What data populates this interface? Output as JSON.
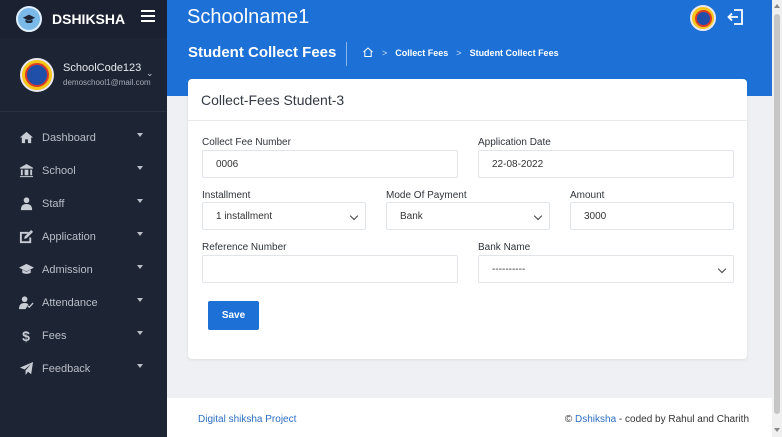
{
  "brand": {
    "name": "DSHIKSHA",
    "logo_icon": "graduation-cap-icon"
  },
  "profile": {
    "name": "SchoolCode123",
    "email": "demoschool1@mail.com"
  },
  "sidebar": {
    "items": [
      {
        "label": "Dashboard",
        "icon": "home-icon"
      },
      {
        "label": "School",
        "icon": "school-icon"
      },
      {
        "label": "Staff",
        "icon": "staff-icon"
      },
      {
        "label": "Application",
        "icon": "application-icon"
      },
      {
        "label": "Admission",
        "icon": "admission-icon"
      },
      {
        "label": "Attendance",
        "icon": "attendance-icon"
      },
      {
        "label": "Fees",
        "icon": "dollar-icon"
      },
      {
        "label": "Feedback",
        "icon": "paper-plane-icon"
      }
    ]
  },
  "header": {
    "school_name": "Schoolname1"
  },
  "subheader": {
    "page_title": "Student Collect Fees",
    "breadcrumb": [
      "Collect Fees",
      "Student Collect Fees"
    ]
  },
  "form": {
    "title": "Collect-Fees Student-3",
    "collect_fee_number": {
      "label": "Collect Fee Number",
      "value": "0006"
    },
    "application_date": {
      "label": "Application Date",
      "value": "22-08-2022"
    },
    "installment": {
      "label": "Installment",
      "value": "1 installment"
    },
    "mode_of_payment": {
      "label": "Mode Of Payment",
      "value": "Bank"
    },
    "amount": {
      "label": "Amount",
      "value": "3000"
    },
    "reference_number": {
      "label": "Reference Number",
      "value": ""
    },
    "bank_name": {
      "label": "Bank Name",
      "value": "----------"
    },
    "save_label": "Save"
  },
  "footer": {
    "left": "Digital shiksha Project",
    "right_prefix": "©",
    "right_link": "Dshiksha",
    "right_suffix": "- coded by Rahul and Charith"
  },
  "colors": {
    "primary": "#1d71d6",
    "sidebar": "#1d2433",
    "background": "#eef0f4"
  }
}
